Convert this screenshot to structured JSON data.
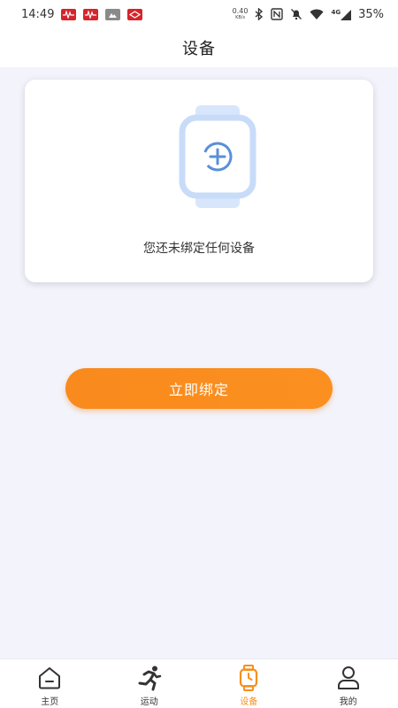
{
  "status_bar": {
    "time": "14:49",
    "net_speed": "0.40",
    "net_speed_unit": "KB/s",
    "signal_label": "4G",
    "battery": "35%"
  },
  "header": {
    "title": "设备"
  },
  "device_card": {
    "empty_text": "您还未绑定任何设备"
  },
  "bind_button": {
    "label": "立即绑定"
  },
  "nav": {
    "items": [
      {
        "label": "主页",
        "icon": "home-icon"
      },
      {
        "label": "运动",
        "icon": "running-person-icon"
      },
      {
        "label": "设备",
        "icon": "watch-icon",
        "active": true
      },
      {
        "label": "我的",
        "icon": "person-icon"
      }
    ]
  },
  "colors": {
    "accent": "#f98a1d",
    "watch_illustration": "#c8dcf9",
    "plus_icon": "#5a8fd8",
    "background": "#f2f3fb"
  }
}
